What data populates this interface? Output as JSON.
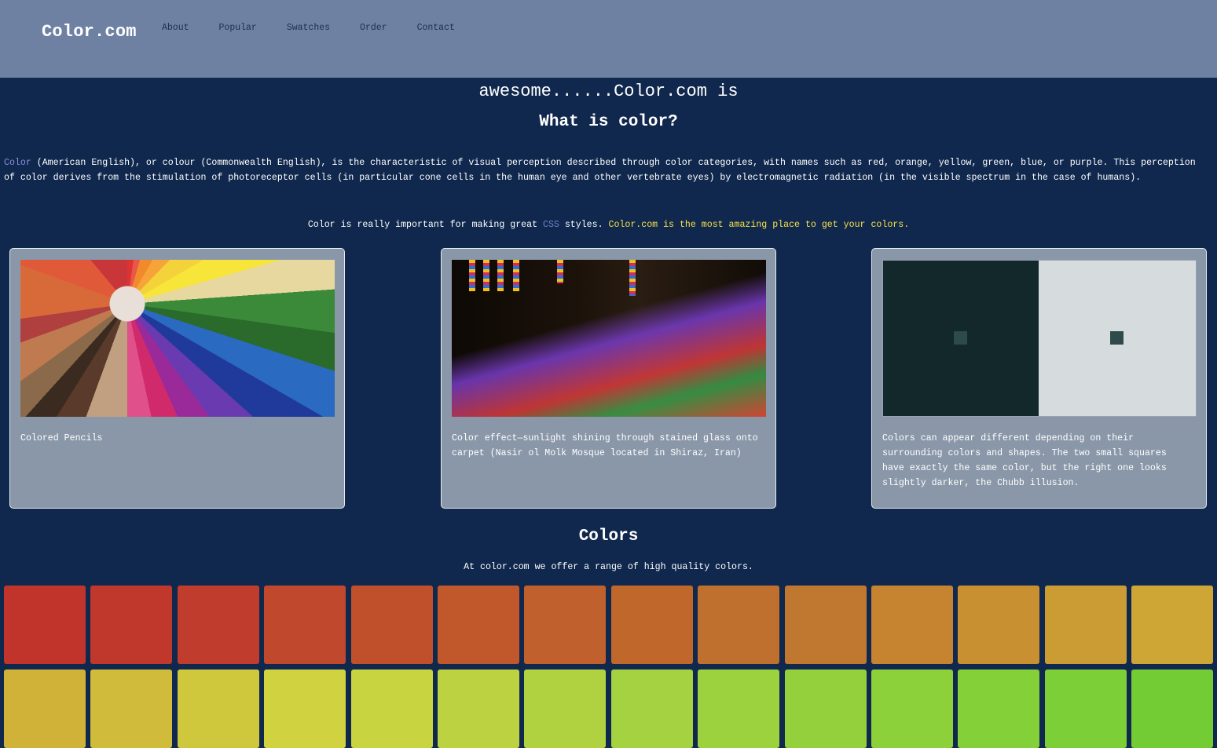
{
  "header": {
    "logo": "Color.com",
    "nav": [
      "About",
      "Popular",
      "Swatches",
      "Order",
      "Contact"
    ]
  },
  "tagline": "awesome......Color.com is",
  "heading": "What is color?",
  "intro": {
    "link_word": "Color",
    "text": " (American English), or colour (Commonwealth English), is the characteristic of visual perception described through color categories, with names such as red, orange, yellow, green, blue, or purple. This perception of color derives from the stimulation of photoreceptor cells (in particular cone cells in the human eye and other vertebrate eyes) by electromagnetic radiation (in the visible spectrum in the case of humans)."
  },
  "important": {
    "before": "Color is really important for making great ",
    "css_link": "CSS",
    "after": " styles. ",
    "promo": "Color.com is the most amazing place to get your colors."
  },
  "cards": [
    {
      "caption": "Colored Pencils",
      "image": "colored-pencils"
    },
    {
      "caption": "Color effect—sunlight shining through stained glass onto carpet (Nasir ol Molk Mosque located in Shiraz, Iran)",
      "image": "stained-glass-carpet"
    },
    {
      "caption": "Colors can appear different depending on their surrounding colors and shapes. The two small squares have exactly the same color, but the right one looks slightly darker, the Chubb illusion.",
      "image": "chubb-illusion"
    }
  ],
  "colors_section": {
    "title": "Colors",
    "subtitle": "At color.com we offer a range of high quality colors."
  },
  "swatch_colors": [
    [
      "#c0342c",
      "#c0382c",
      "#c03c2c",
      "#c0482c",
      "#c0502c",
      "#c0582c",
      "#c0602c",
      "#c0682c",
      "#c0702e",
      "#c07830",
      "#c68430",
      "#c99032",
      "#cc9c34",
      "#cea636"
    ],
    [
      "#d0b238",
      "#d0bc3a",
      "#d0c83c",
      "#d0d240",
      "#c8d440",
      "#bcd240",
      "#b0d240",
      "#a4d240",
      "#9cd23e",
      "#94d03c",
      "#8cd03a",
      "#84d038",
      "#7ccf36",
      "#74cc34"
    ]
  ]
}
